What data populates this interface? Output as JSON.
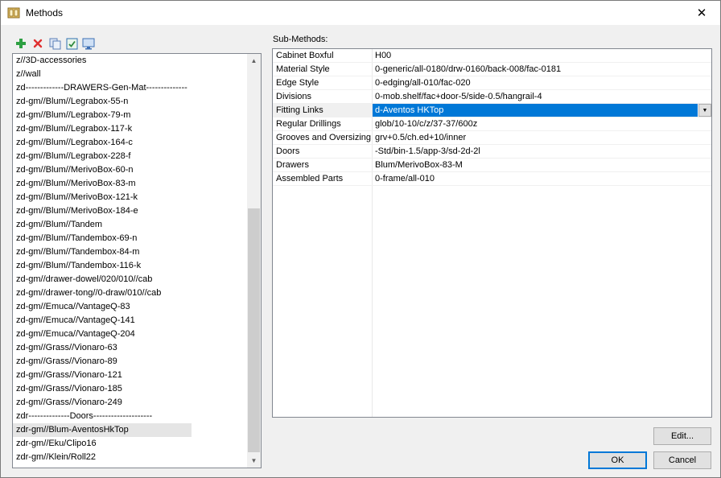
{
  "window": {
    "title": "Methods",
    "close_glyph": "✕"
  },
  "toolbar": {
    "buttons": [
      {
        "name": "add-icon",
        "color": "#2ea043"
      },
      {
        "name": "delete-icon",
        "color": "#e03030"
      },
      {
        "name": "copy-icon",
        "color": "#5b7fb8"
      },
      {
        "name": "properties-icon",
        "color": "#2f8a3c"
      },
      {
        "name": "display-icon",
        "color": "#3d6fb5"
      }
    ]
  },
  "methods_list": {
    "items": [
      "z//3D-accessories",
      "z//wall",
      "zd-------------DRAWERS-Gen-Mat--------------",
      "zd-gm//Blum//Legrabox-55-n",
      "zd-gm//Blum//Legrabox-79-m",
      "zd-gm//Blum//Legrabox-117-k",
      "zd-gm//Blum//Legrabox-164-c",
      "zd-gm//Blum//Legrabox-228-f",
      "zd-gm//Blum//MerivoBox-60-n",
      "zd-gm//Blum//MerivoBox-83-m",
      "zd-gm//Blum//MerivoBox-121-k",
      "zd-gm//Blum//MerivoBox-184-e",
      "zd-gm//Blum//Tandem",
      "zd-gm//Blum//Tandembox-69-n",
      "zd-gm//Blum//Tandembox-84-m",
      "zd-gm//Blum//Tandembox-116-k",
      "zd-gm//drawer-dowel/020/010//cab",
      "zd-gm//drawer-tong//0-draw/010//cab",
      "zd-gm//Emuca//VantageQ-83",
      "zd-gm//Emuca//VantageQ-141",
      "zd-gm//Emuca//VantageQ-204",
      "zd-gm//Grass//Vionaro-63",
      "zd-gm//Grass//Vionaro-89",
      "zd-gm//Grass//Vionaro-121",
      "zd-gm//Grass//Vionaro-185",
      "zd-gm//Grass//Vionaro-249",
      "zdr--------------Doors--------------------",
      "zdr-gm//Blum-AventosHkTop",
      "zdr-gm//Eku/Clipo16",
      "zdr-gm//Klein/Roll22"
    ],
    "selected_index": 27,
    "scroll_up_glyph": "▲",
    "scroll_down_glyph": "▼"
  },
  "sub_methods": {
    "label": "Sub-Methods:",
    "rows": [
      {
        "name": "Cabinet Boxful",
        "value": "H00"
      },
      {
        "name": "Material Style",
        "value": "0-generic/all-0180/drw-0160/back-008/fac-0181"
      },
      {
        "name": "Edge Style",
        "value": "0-edging/all-010/fac-020"
      },
      {
        "name": "Divisions",
        "value": "0-mob.shelf/fac+door-5/side-0.5/hangrail-4"
      },
      {
        "name": "Fitting Links",
        "value": "d-Aventos HKTop"
      },
      {
        "name": "Regular Drillings",
        "value": "glob/10-10/c/z/37-37/600z"
      },
      {
        "name": "Grooves and Oversizing",
        "value": "grv+0.5/ch.ed+10/inner"
      },
      {
        "name": "Doors",
        "value": "-Std/bin-1.5/app-3/sd-2d-2l"
      },
      {
        "name": "Drawers",
        "value": "Blum/MerivoBox-83-M"
      },
      {
        "name": "Assembled Parts",
        "value": "0-frame/all-010"
      }
    ],
    "active_index": 4,
    "combo_arrow_glyph": "▼"
  },
  "buttons": {
    "edit": "Edit...",
    "ok": "OK",
    "cancel": "Cancel"
  }
}
